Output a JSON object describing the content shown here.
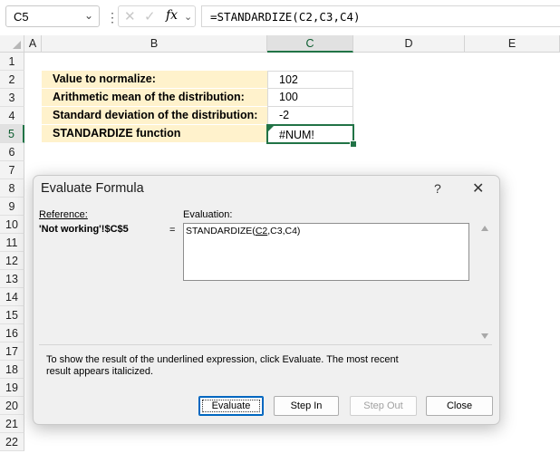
{
  "formula_bar": {
    "name_box": "C5",
    "cancel_glyph": "✕",
    "enter_glyph": "✓",
    "fx_glyph": "fx",
    "formula": "=STANDARDIZE(C2,C3,C4)"
  },
  "columns": [
    "A",
    "B",
    "C",
    "D",
    "E"
  ],
  "rows": [
    "1",
    "2",
    "3",
    "4",
    "5",
    "6",
    "7",
    "8",
    "9",
    "10",
    "11",
    "12",
    "13",
    "14",
    "15",
    "16",
    "17",
    "18",
    "19",
    "20",
    "21",
    "22"
  ],
  "table": [
    {
      "label": "Value to normalize:",
      "value": "102"
    },
    {
      "label": "Arithmetic mean of the distribution:",
      "value": "100"
    },
    {
      "label": "Standard deviation of the distribution:",
      "value": "-2"
    },
    {
      "label": "STANDARDIZE function",
      "value": "#NUM!"
    }
  ],
  "dialog": {
    "title": "Evaluate Formula",
    "help": "?",
    "close": "✕",
    "reference_label": "Reference:",
    "reference_value": "'Not working'!$C$5",
    "equals": "=",
    "evaluation_label": "Evaluation:",
    "evaluation_prefix": "STANDARDIZE(",
    "evaluation_underlined": "C2",
    "evaluation_suffix": ",C3,C4)",
    "help_line1": "To show the result of the underlined expression, click Evaluate.  The most recent",
    "help_line2": "result appears italicized.",
    "buttons": {
      "evaluate": "Evaluate",
      "step_in": "Step In",
      "step_out": "Step Out",
      "close": "Close"
    }
  },
  "colors": {
    "accent": "#217346",
    "label_fill": "#fff2cc"
  }
}
